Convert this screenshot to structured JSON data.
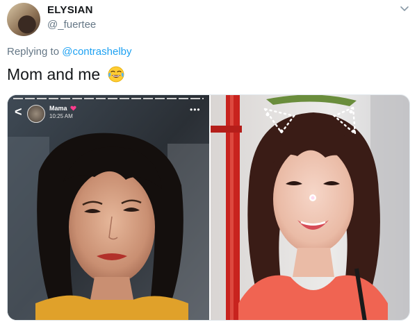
{
  "tweet": {
    "display_name": "ELYSIAN",
    "handle": "@_fuertee",
    "reply_prefix": "Replying to",
    "reply_to": "@contrashelby",
    "text": "Mom and me"
  },
  "story_overlay": {
    "back_label": "<",
    "name": "Mama",
    "time": "10:25 AM",
    "more_label": "•••"
  },
  "colors": {
    "link": "#1da1f2",
    "secondary_text": "#657786",
    "primary_text": "#14171a"
  },
  "icons": [
    "chevron-down-icon",
    "face-with-tears-of-joy-icon",
    "back-arrow-icon",
    "heart-icon",
    "more-icon"
  ]
}
